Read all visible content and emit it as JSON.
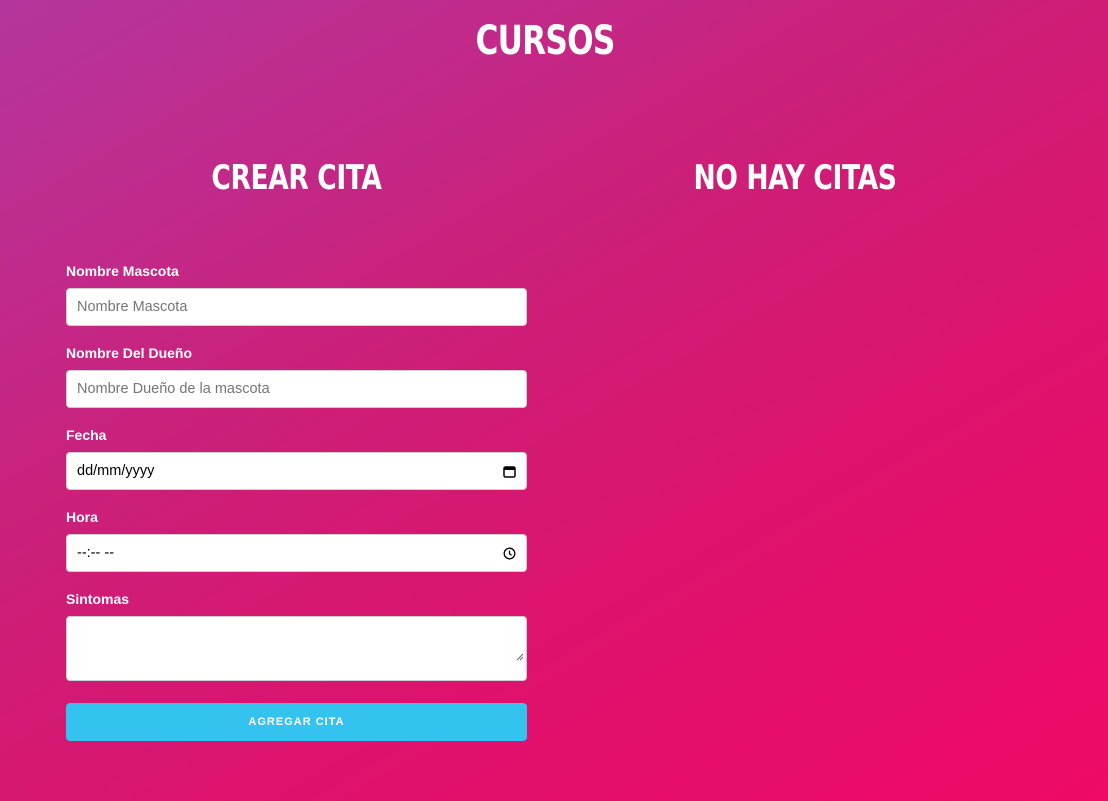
{
  "header": {
    "title": "CURSOS"
  },
  "form_panel": {
    "title": "CREAR CITA",
    "fields": [
      {
        "label": "Nombre Mascota",
        "placeholder": "Nombre Mascota"
      },
      {
        "label": "Nombre Del Dueño",
        "placeholder": "Nombre Dueño de la mascota"
      },
      {
        "label": "Fecha",
        "value": "dd/mm/yyyy",
        "icon": "calendar-icon"
      },
      {
        "label": "Hora",
        "value": "--:-- --",
        "icon": "clock-icon"
      },
      {
        "label": "Sintomas",
        "value": ""
      }
    ],
    "submit_label": "AGREGAR CITA"
  },
  "list_panel": {
    "title": "NO HAY CITAS"
  },
  "colors": {
    "gradient_start": "#b4369d",
    "gradient_end": "#ee0a66",
    "button": "#34c3ee"
  }
}
